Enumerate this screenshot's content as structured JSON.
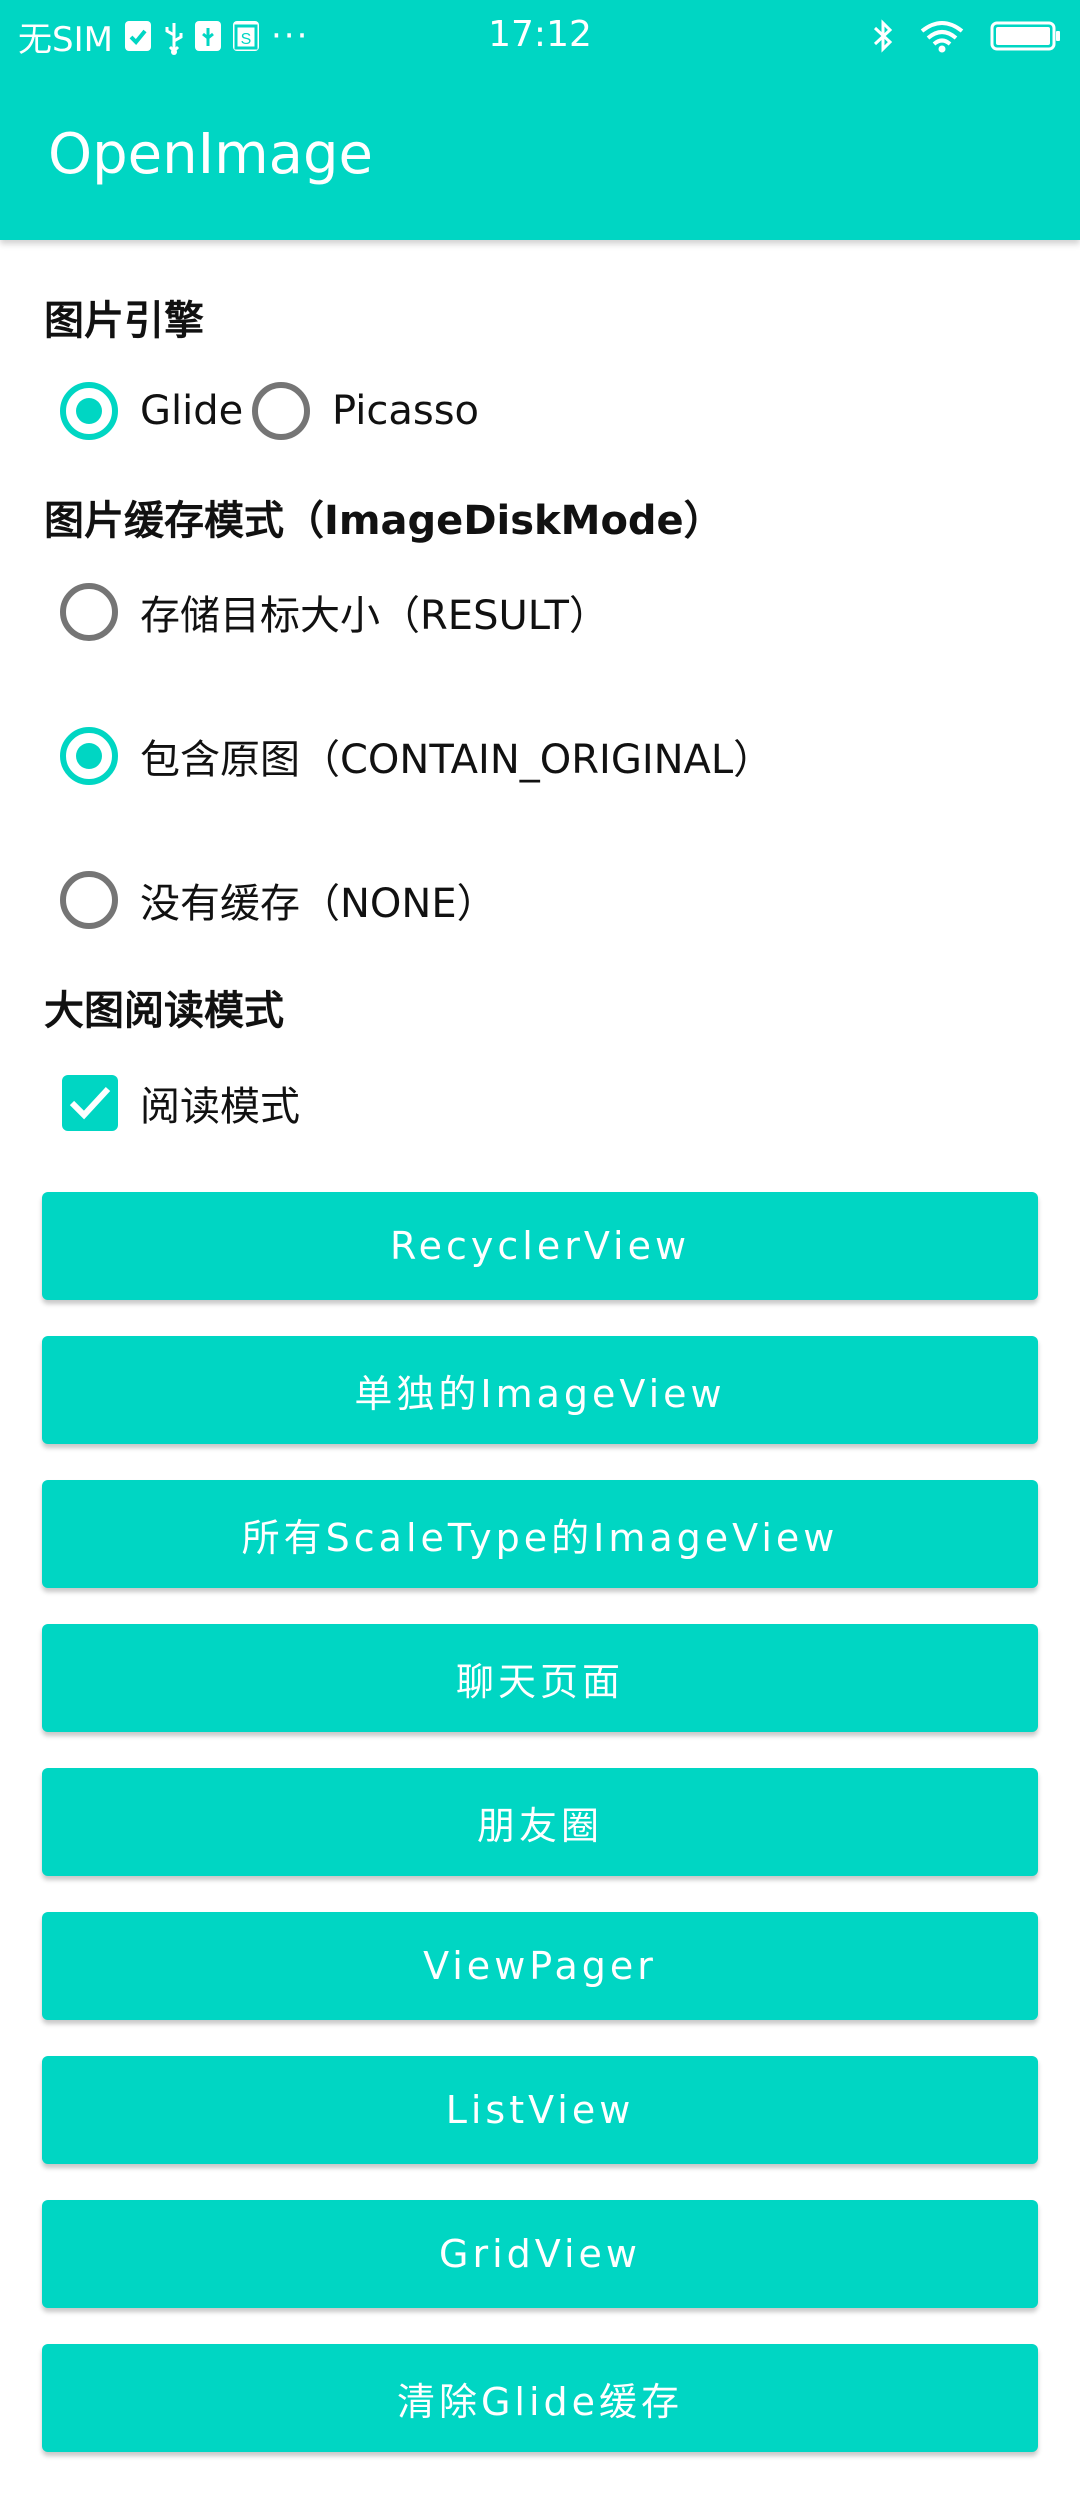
{
  "colors": {
    "accent": "#00D6C3",
    "text": "#111111",
    "radio_off": "#757575"
  },
  "status_bar": {
    "carrier": "无SIM",
    "time": "17:12",
    "icons_left": [
      "check-notification-icon",
      "usb-icon",
      "usb-debug-icon",
      "app-s-icon",
      "more-dots-icon"
    ],
    "more": "···",
    "icons_right": [
      "bluetooth-icon",
      "wifi-icon",
      "battery-icon"
    ]
  },
  "app_bar": {
    "title": "OpenImage"
  },
  "engine": {
    "label": "图片引擎",
    "options": [
      {
        "label": "Glide",
        "selected": true
      },
      {
        "label": "Picasso",
        "selected": false
      }
    ]
  },
  "disk_mode": {
    "label": "图片缓存模式（ImageDiskMode）",
    "options": [
      {
        "label": "存储目标大小（RESULT）",
        "selected": false
      },
      {
        "label": "包含原图（CONTAIN_ORIGINAL）",
        "selected": true
      },
      {
        "label": "没有缓存（NONE）",
        "selected": false
      }
    ]
  },
  "reading": {
    "label": "大图阅读模式",
    "checkbox": {
      "label": "阅读模式",
      "checked": true
    }
  },
  "buttons": [
    {
      "label": "RecyclerView"
    },
    {
      "label": "单独的ImageView"
    },
    {
      "label": "所有ScaleType的ImageView"
    },
    {
      "label": "聊天页面"
    },
    {
      "label": "朋友圈"
    },
    {
      "label": "ViewPager"
    },
    {
      "label": "ListView"
    },
    {
      "label": "GridView"
    },
    {
      "label": "清除Glide缓存"
    }
  ]
}
